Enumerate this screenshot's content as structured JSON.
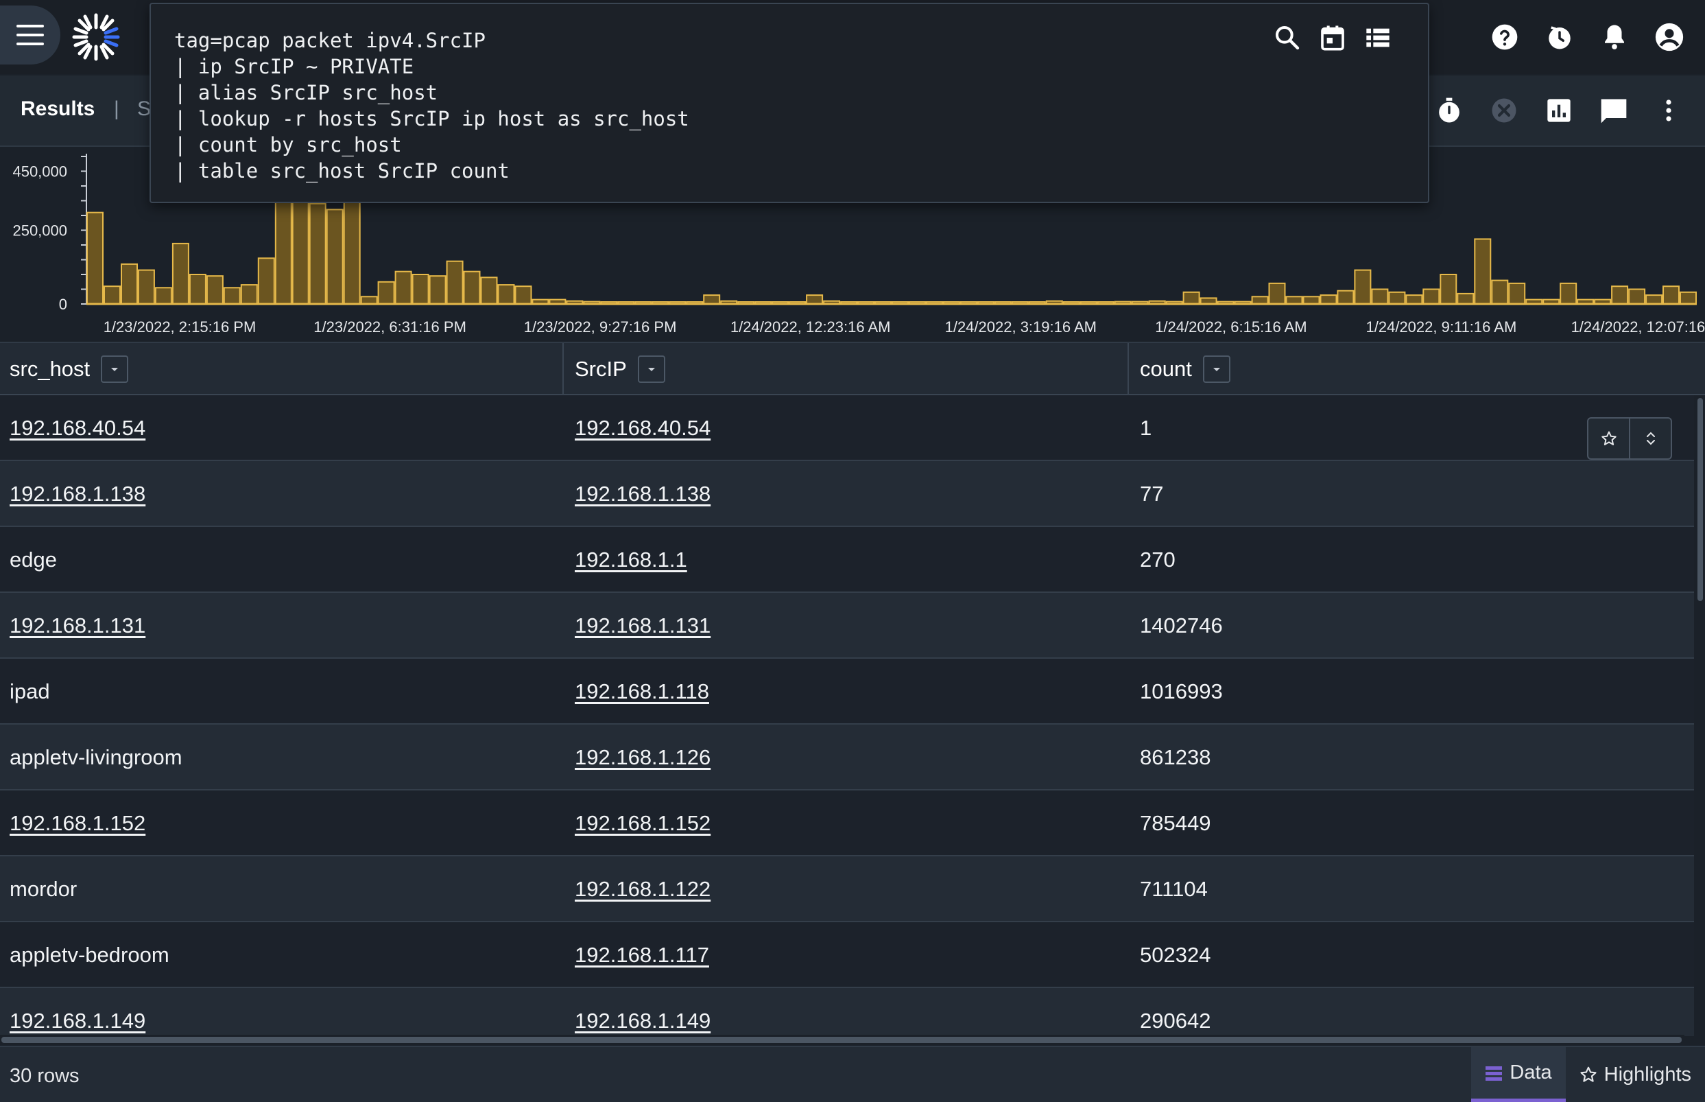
{
  "topbar": {
    "menu_icon": "hamburger-menu-icon",
    "logo_icon": "gravwell-starburst-logo",
    "icons": [
      "help-icon",
      "history-clock-icon",
      "notifications-bell-icon",
      "account-circle-icon"
    ]
  },
  "query": {
    "lines": [
      "tag=pcap packet ipv4.SrcIP",
      "| ip SrcIP ~ PRIVATE",
      "| alias SrcIP src_host",
      "| lookup -r hosts SrcIP ip host as src_host",
      "| count by src_host",
      "| table src_host SrcIP count"
    ],
    "icons": [
      "search-icon",
      "calendar-icon",
      "list-view-icon"
    ]
  },
  "results_bar": {
    "tab_label": "Results",
    "separator": "|",
    "stats_label": "S",
    "actions": [
      "timer-icon",
      "cancel-icon",
      "chart-icon",
      "comment-icon",
      "more-vert-icon"
    ]
  },
  "chart_data": {
    "type": "bar",
    "title": "",
    "xlabel": "",
    "ylabel": "",
    "ylim": [
      0,
      500000
    ],
    "y_ticks": [
      "450,000",
      "250,000",
      "0"
    ],
    "x_ticks": [
      "1/23/2022, 2:15:16 PM",
      "1/23/2022, 6:31:16 PM",
      "1/23/2022, 9:27:16 PM",
      "1/24/2022, 12:23:16 AM",
      "1/24/2022, 3:19:16 AM",
      "1/24/2022, 6:15:16 AM",
      "1/24/2022, 9:11:16 AM",
      "1/24/2022, 12:07:16 PM"
    ],
    "values": [
      310000,
      60000,
      135000,
      115000,
      55000,
      205000,
      100000,
      95000,
      55000,
      65000,
      155000,
      460000,
      350000,
      340000,
      320000,
      500000,
      25000,
      75000,
      110000,
      100000,
      95000,
      145000,
      110000,
      90000,
      65000,
      60000,
      15000,
      15000,
      10000,
      8000,
      5000,
      5000,
      5000,
      5000,
      5000,
      5000,
      30000,
      10000,
      5000,
      5000,
      5000,
      5000,
      30000,
      10000,
      5000,
      5000,
      5000,
      5000,
      5000,
      5000,
      5000,
      5000,
      5000,
      3000,
      3000,
      3000,
      10000,
      3000,
      3000,
      3000,
      8000,
      8000,
      10000,
      8000,
      40000,
      20000,
      8000,
      8000,
      25000,
      70000,
      25000,
      25000,
      30000,
      45000,
      115000,
      50000,
      40000,
      30000,
      50000,
      100000,
      35000,
      220000,
      80000,
      70000,
      15000,
      15000,
      70000,
      15000,
      15000,
      60000,
      50000,
      30000,
      60000,
      40000
    ],
    "bar_color": "#e6b94a",
    "grid": false
  },
  "table": {
    "columns": [
      "src_host",
      "SrcIP",
      "count"
    ],
    "rows": [
      {
        "src_host": "192.168.40.54",
        "src_link": true,
        "SrcIP": "192.168.40.54",
        "count": "1"
      },
      {
        "src_host": "192.168.1.138",
        "src_link": true,
        "SrcIP": "192.168.1.138",
        "count": "77"
      },
      {
        "src_host": "edge",
        "src_link": false,
        "SrcIP": "192.168.1.1",
        "count": "270"
      },
      {
        "src_host": "192.168.1.131",
        "src_link": true,
        "SrcIP": "192.168.1.131",
        "count": "1402746"
      },
      {
        "src_host": "ipad",
        "src_link": false,
        "SrcIP": "192.168.1.118",
        "count": "1016993"
      },
      {
        "src_host": "appletv-livingroom",
        "src_link": false,
        "SrcIP": "192.168.1.126",
        "count": "861238"
      },
      {
        "src_host": "192.168.1.152",
        "src_link": true,
        "SrcIP": "192.168.1.152",
        "count": "785449"
      },
      {
        "src_host": "mordor",
        "src_link": false,
        "SrcIP": "192.168.1.122",
        "count": "711104"
      },
      {
        "src_host": "appletv-bedroom",
        "src_link": false,
        "SrcIP": "192.168.1.117",
        "count": "502324"
      },
      {
        "src_host": "192.168.1.149",
        "src_link": true,
        "SrcIP": "192.168.1.149",
        "count": "290642"
      }
    ],
    "row_tools": [
      "star-icon",
      "expand-icon"
    ]
  },
  "footer": {
    "row_count": "30 rows",
    "tabs": [
      {
        "label": "Data",
        "icon": "data-list-icon",
        "active": true
      },
      {
        "label": "Highlights",
        "icon": "star-outline-icon",
        "active": false
      }
    ],
    "accent": "#7b61d1"
  }
}
